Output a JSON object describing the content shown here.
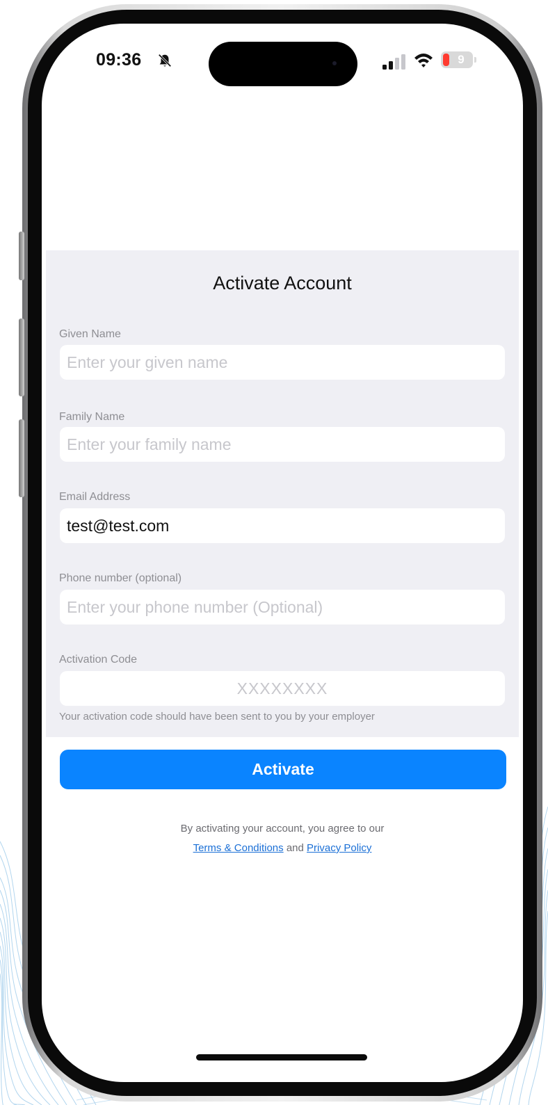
{
  "status_bar": {
    "time": "09:36",
    "battery_level": "9",
    "icons": [
      "bell-slash-icon",
      "signal-icon",
      "wifi-icon",
      "battery-icon"
    ]
  },
  "form": {
    "title": "Activate Account",
    "given_name": {
      "label": "Given Name",
      "placeholder": "Enter your given name",
      "value": ""
    },
    "family_name": {
      "label": "Family Name",
      "placeholder": "Enter your family name",
      "value": ""
    },
    "email": {
      "label": "Email Address",
      "placeholder": "",
      "value": "test@test.com"
    },
    "phone": {
      "label": "Phone number (optional)",
      "placeholder": "Enter your phone number (Optional)",
      "value": ""
    },
    "activation_code": {
      "label": "Activation Code",
      "placeholder": "XXXXXXXX",
      "value": "",
      "hint": "Your activation code should have been sent to you by your employer"
    },
    "submit_label": "Activate",
    "agreement": {
      "text": "By activating your account, you agree to our",
      "terms_link": "Terms & Conditions",
      "conjunction": "and",
      "privacy_link": "Privacy Policy"
    }
  },
  "colors": {
    "accent": "#0a84ff",
    "card_background": "#efeff4",
    "link": "#1a6fd6",
    "battery_low": "#ff3b30"
  }
}
